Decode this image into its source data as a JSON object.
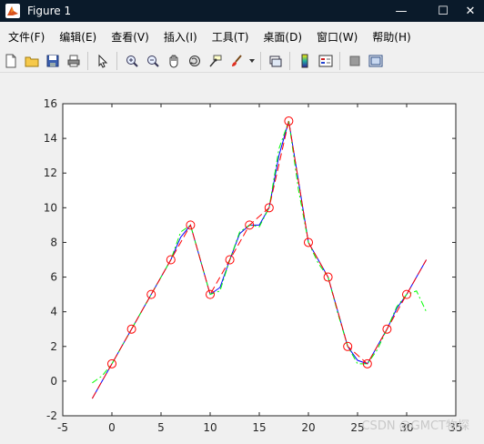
{
  "window": {
    "title": "Figure 1",
    "controls": {
      "minimize": "—",
      "maximize": "☐",
      "close": "✕"
    }
  },
  "menu": {
    "items": [
      "文件(F)",
      "编辑(E)",
      "查看(V)",
      "插入(I)",
      "工具(T)",
      "桌面(D)",
      "窗口(W)",
      "帮助(H)"
    ]
  },
  "toolbar": {
    "buttons": [
      "new-figure-icon",
      "open-file-icon",
      "save-icon",
      "print-icon",
      "edit-plot-cursor-icon",
      "zoom-in-icon",
      "zoom-out-icon",
      "pan-hand-icon",
      "rotate-3d-icon",
      "data-cursor-icon",
      "brush-icon",
      "brush-dropdown-icon",
      "link-plot-icon",
      "colorbar-icon",
      "legend-icon",
      "hide-plot-tools-icon",
      "show-plot-tools-icon"
    ]
  },
  "watermark": "CSDN @GMCT物探",
  "chart_data": {
    "type": "line",
    "xlim": [
      -5,
      35
    ],
    "ylim": [
      -2,
      16
    ],
    "xticks": [
      "-5",
      "0",
      "5",
      "10",
      "15",
      "20",
      "25",
      "30",
      "35"
    ],
    "yticks": [
      "-2",
      "0",
      "2",
      "4",
      "6",
      "8",
      "10",
      "12",
      "14",
      "16"
    ],
    "grid": false,
    "series": [
      {
        "style": "circles",
        "color": "#ff0000",
        "x": [
          0,
          2,
          4,
          6,
          8,
          10,
          12,
          14,
          16,
          18,
          20,
          22,
          24,
          26,
          28,
          30
        ],
        "y": [
          1,
          3,
          5,
          7,
          9,
          5,
          7,
          9,
          10,
          15,
          8,
          6,
          2,
          1,
          3,
          5
        ]
      },
      {
        "style": "solid",
        "color": "#0000ff",
        "x": [
          -2,
          -1,
          0,
          1,
          2,
          3,
          4,
          5,
          6,
          7,
          8,
          9,
          10,
          11,
          12,
          13,
          14,
          15,
          16,
          17,
          18,
          19,
          20,
          21,
          22,
          23,
          24,
          25,
          26,
          27,
          28,
          29,
          30,
          31,
          32
        ],
        "y": [
          -1,
          0,
          1,
          2,
          3,
          4,
          5,
          6,
          7,
          8.3,
          9,
          7,
          5,
          5.4,
          7,
          8.5,
          9,
          9,
          10,
          13,
          15,
          11.5,
          8,
          7,
          6,
          4,
          2,
          1.2,
          1,
          2,
          3,
          4.2,
          5,
          6,
          7
        ]
      },
      {
        "style": "dashdot",
        "color": "#00ff00",
        "x": [
          -2,
          -1,
          0,
          1,
          2,
          3,
          4,
          5,
          6,
          7,
          8,
          9,
          10,
          11,
          12,
          13,
          14,
          15,
          16,
          17,
          18,
          19,
          20,
          21,
          22,
          23,
          24,
          25,
          26,
          27,
          28,
          29,
          30,
          31,
          32
        ],
        "y": [
          -0.1,
          0.3,
          1,
          2,
          3,
          4,
          5,
          6,
          7,
          8.6,
          9,
          7,
          5,
          5.2,
          7,
          8.6,
          9,
          8.9,
          10,
          13.4,
          15,
          11,
          8,
          6.8,
          6,
          3.9,
          2,
          1,
          1,
          1.8,
          3,
          4.3,
          5,
          5.2,
          4
        ]
      },
      {
        "style": "dashed",
        "color": "#ff0000",
        "x": [
          -2,
          0,
          2,
          4,
          6,
          8,
          10,
          12,
          14,
          16,
          18,
          20,
          22,
          24,
          26,
          28,
          30,
          32
        ],
        "y": [
          -1,
          1,
          3,
          5,
          7,
          9,
          5,
          7,
          9,
          10,
          15,
          8,
          6,
          2,
          1,
          3,
          5,
          7
        ]
      }
    ]
  }
}
